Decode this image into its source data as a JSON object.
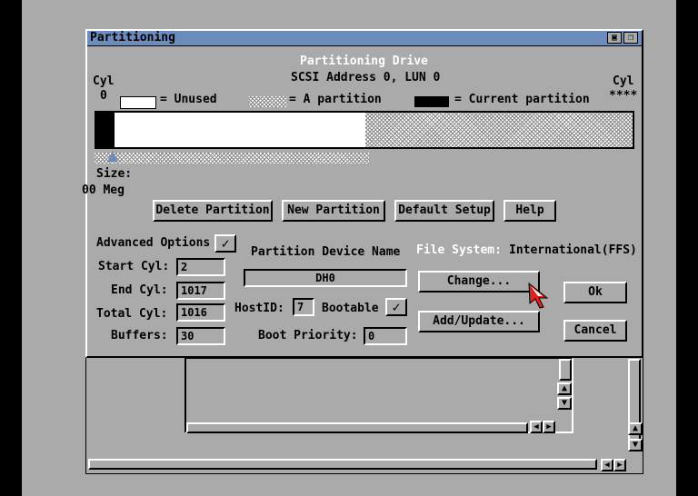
{
  "window": {
    "title": "Partitioning"
  },
  "header": {
    "title": "Partitioning Drive",
    "address": "SCSI Address 0, LUN 0"
  },
  "legend": {
    "cyl_left_label": "Cyl",
    "cyl_left_value": "0",
    "cyl_right_label": "Cyl",
    "cyl_right_value": "****",
    "unused": "= Unused",
    "a_partition": "= A partition",
    "current": "= Current partition"
  },
  "size": {
    "label": "Size:",
    "value": "00 Meg"
  },
  "buttons": {
    "delete": "Delete Partition",
    "new": "New Partition",
    "default": "Default Setup",
    "help": "Help",
    "change": "Change...",
    "add_update": "Add/Update...",
    "ok": "Ok",
    "cancel": "Cancel"
  },
  "advanced": {
    "label": "Advanced Options",
    "checked": "✓"
  },
  "fields": {
    "start_cyl_label": "Start Cyl:",
    "start_cyl": "2",
    "end_cyl_label": "End Cyl:",
    "end_cyl": "1017",
    "total_cyl_label": "Total Cyl:",
    "total_cyl": "1016",
    "buffers_label": "Buffers:",
    "buffers": "30",
    "device_name_label": "Partition Device Name",
    "device_name": "DH0",
    "hostid_label": "HostID:",
    "hostid": "7",
    "bootable_label": "Bootable",
    "bootable_checked": "✓",
    "boot_priority_label": "Boot Priority:",
    "boot_priority": "0"
  },
  "filesystem": {
    "label": "File System:",
    "value": "International(FFS)"
  },
  "colors": {
    "titlebar": "#6b8cbd",
    "workbench": "#aaaaaa",
    "accent_label": "#ffffff"
  }
}
